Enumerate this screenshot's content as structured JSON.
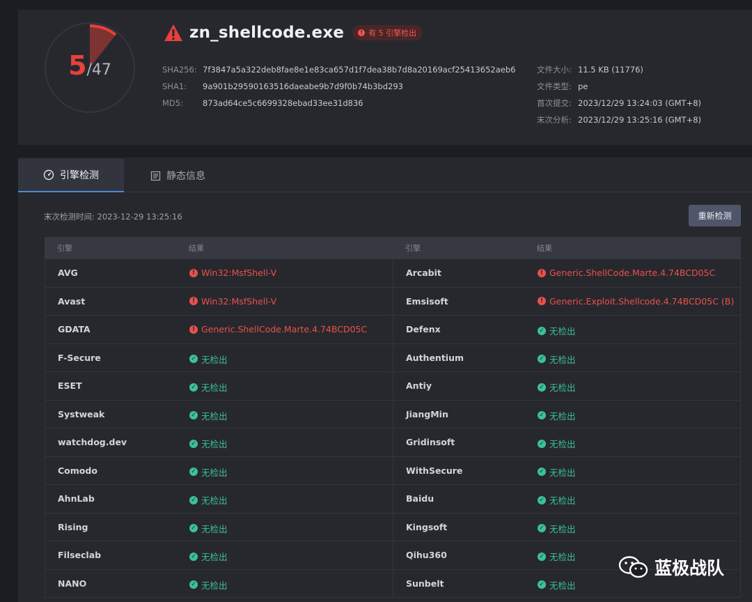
{
  "summary": {
    "detected": "5",
    "total": "/47",
    "file_name": "zn_shellcode.exe",
    "badge": "有 5 引擎检出",
    "hashes": [
      {
        "label": "SHA256:",
        "value": "7f3847a5a322deb8fae8e1e83ca657d1f7dea38b7d8a20169acf25413652aeb6"
      },
      {
        "label": "SHA1:",
        "value": "9a901b29590163516daeabe9b7d9f0b74b3bd293"
      },
      {
        "label": "MD5:",
        "value": "873ad64ce5c6699328ebad33ee31d836"
      }
    ],
    "meta": [
      {
        "label": "文件大小:",
        "value": "11.5 KB (11776)"
      },
      {
        "label": "文件类型:",
        "value": "pe"
      },
      {
        "label": "首次提交:",
        "value": "2023/12/29 13:24:03 (GMT+8)"
      },
      {
        "label": "末次分析:",
        "value": "2023/12/29 13:25:16 (GMT+8)"
      }
    ],
    "detection_ratio": 0.1064
  },
  "tabs": {
    "engine_detection": "引擎检测",
    "static_info": "静态信息"
  },
  "scan": {
    "last_time": "末次检测时间: 2023-12-29 13:25:16",
    "rescan_label": "重新检测"
  },
  "table": {
    "headers": [
      "引擎",
      "结果",
      "引擎",
      "结果"
    ],
    "rows": [
      {
        "left": {
          "engine": "AVG",
          "result": "Win32:MsfShell-V",
          "status": "malicious"
        },
        "right": {
          "engine": "Arcabit",
          "result": "Generic.ShellCode.Marte.4.74BCD05C",
          "status": "malicious"
        }
      },
      {
        "left": {
          "engine": "Avast",
          "result": "Win32:MsfShell-V",
          "status": "malicious"
        },
        "right": {
          "engine": "Emsisoft",
          "result": "Generic.Exploit.Shellcode.4.74BCD05C (B)",
          "status": "malicious"
        }
      },
      {
        "left": {
          "engine": "GDATA",
          "result": "Generic.ShellCode.Marte.4.74BCD05C",
          "status": "malicious"
        },
        "right": {
          "engine": "Defenx",
          "result": "无检出",
          "status": "clean"
        }
      },
      {
        "left": {
          "engine": "F-Secure",
          "result": "无检出",
          "status": "clean"
        },
        "right": {
          "engine": "Authentium",
          "result": "无检出",
          "status": "clean"
        }
      },
      {
        "left": {
          "engine": "ESET",
          "result": "无检出",
          "status": "clean"
        },
        "right": {
          "engine": "Antiy",
          "result": "无检出",
          "status": "clean"
        }
      },
      {
        "left": {
          "engine": "Systweak",
          "result": "无检出",
          "status": "clean"
        },
        "right": {
          "engine": "JiangMin",
          "result": "无检出",
          "status": "clean"
        }
      },
      {
        "left": {
          "engine": "watchdog.dev",
          "result": "无检出",
          "status": "clean"
        },
        "right": {
          "engine": "Gridinsoft",
          "result": "无检出",
          "status": "clean"
        }
      },
      {
        "left": {
          "engine": "Comodo",
          "result": "无检出",
          "status": "clean"
        },
        "right": {
          "engine": "WithSecure",
          "result": "无检出",
          "status": "clean"
        }
      },
      {
        "left": {
          "engine": "AhnLab",
          "result": "无检出",
          "status": "clean"
        },
        "right": {
          "engine": "Baidu",
          "result": "无检出",
          "status": "clean"
        }
      },
      {
        "left": {
          "engine": "Rising",
          "result": "无检出",
          "status": "clean"
        },
        "right": {
          "engine": "Kingsoft",
          "result": "无检出",
          "status": "clean"
        }
      },
      {
        "left": {
          "engine": "Filseclab",
          "result": "无检出",
          "status": "clean"
        },
        "right": {
          "engine": "Qihu360",
          "result": "无检出",
          "status": "clean"
        }
      },
      {
        "left": {
          "engine": "NANO",
          "result": "无检出",
          "status": "clean"
        },
        "right": {
          "engine": "Sunbelt",
          "result": "无检出",
          "status": "clean"
        }
      }
    ]
  },
  "watermark": {
    "text": "蓝极战队",
    "icon": "wechat-icon"
  },
  "colors": {
    "malicious": "#e8524a",
    "clean": "#3bc197",
    "accent": "#4f8ad8"
  }
}
